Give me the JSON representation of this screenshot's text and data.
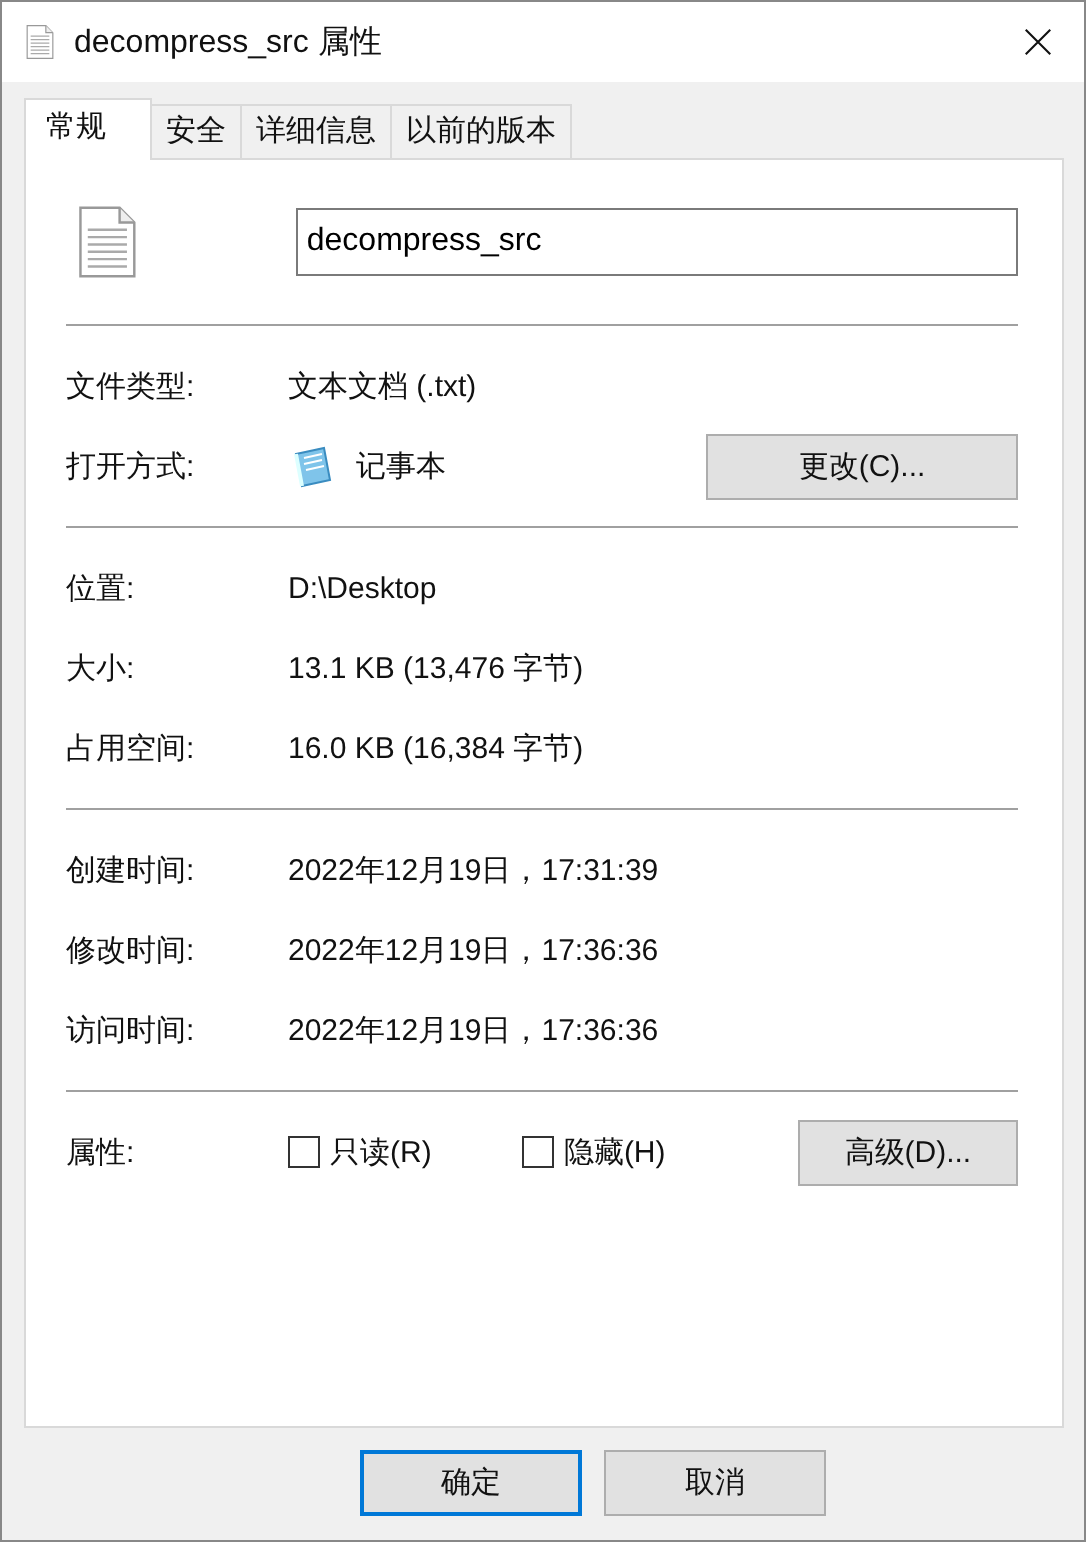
{
  "window": {
    "title": "decompress_src 属性"
  },
  "tabs": [
    {
      "label": "常规",
      "selected": true
    },
    {
      "label": "安全",
      "selected": false
    },
    {
      "label": "详细信息",
      "selected": false
    },
    {
      "label": "以前的版本",
      "selected": false
    }
  ],
  "file": {
    "name": "decompress_src"
  },
  "sections": [
    [
      {
        "kind": "text",
        "label": "文件类型:",
        "value": "文本文档 (.txt)"
      },
      {
        "kind": "app",
        "label": "打开方式:",
        "value": "记事本",
        "button": "更改(C)..."
      }
    ],
    [
      {
        "kind": "text",
        "label": "位置:",
        "value": "D:\\Desktop"
      },
      {
        "kind": "text",
        "label": "大小:",
        "value": "13.1 KB (13,476 字节)"
      },
      {
        "kind": "text",
        "label": "占用空间:",
        "value": "16.0 KB (16,384 字节)"
      }
    ],
    [
      {
        "kind": "text",
        "label": "创建时间:",
        "value": "2022年12月19日，17:31:39"
      },
      {
        "kind": "text",
        "label": "修改时间:",
        "value": "2022年12月19日，17:36:36"
      },
      {
        "kind": "text",
        "label": "访问时间:",
        "value": "2022年12月19日，17:36:36"
      }
    ]
  ],
  "attributes": {
    "label": "属性:",
    "checkboxes": [
      {
        "label": "只读(R)",
        "checked": false
      },
      {
        "label": "隐藏(H)",
        "checked": false
      }
    ],
    "button": "高级(D)..."
  },
  "buttons": [
    {
      "label": "确定",
      "default": true
    },
    {
      "label": "取消",
      "default": false
    }
  ]
}
